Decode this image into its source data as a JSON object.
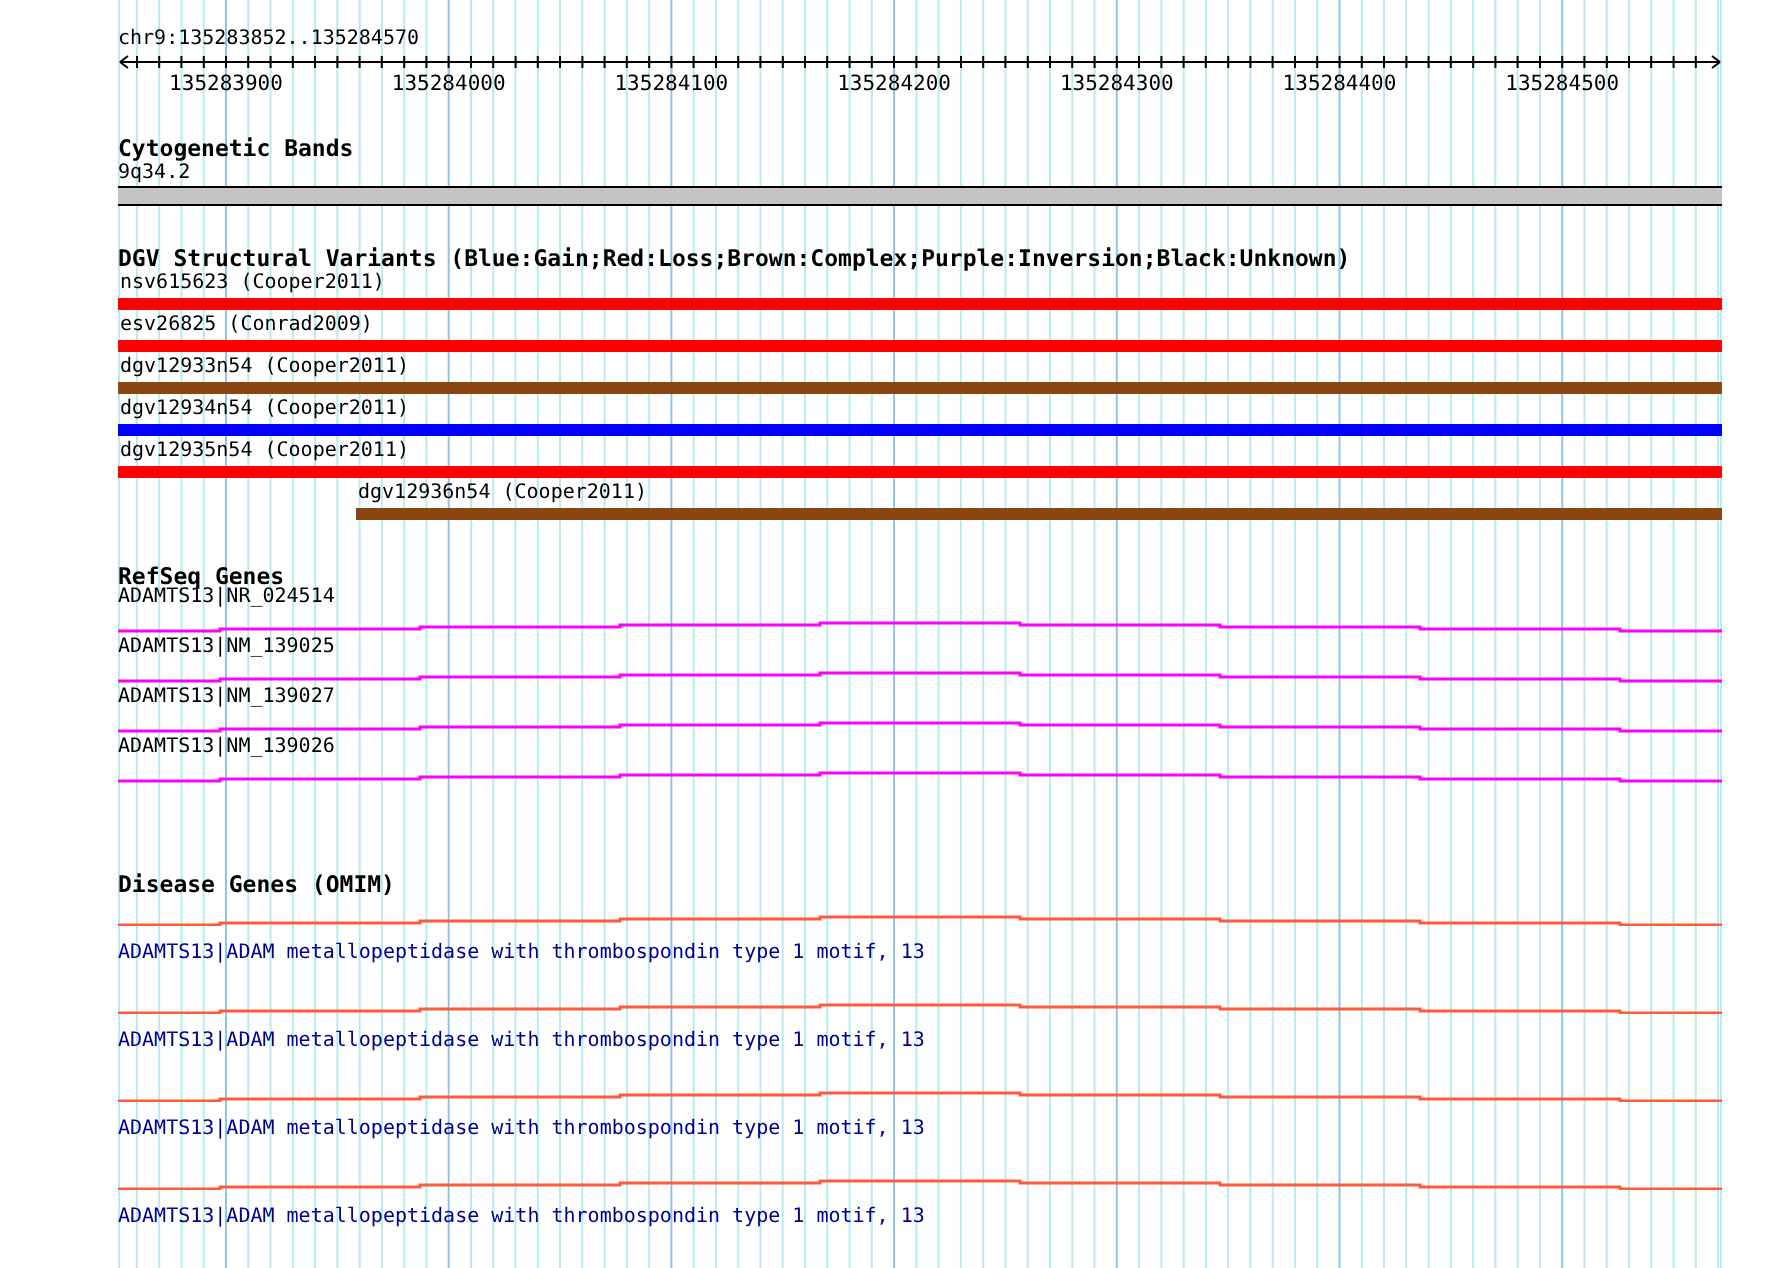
{
  "locus": "chr9:135283852..135284570",
  "ruler": {
    "tick_labels": [
      "135283900",
      "135284000",
      "135284100",
      "135284200",
      "135284300",
      "135284400",
      "135284500"
    ]
  },
  "cytoband_track": {
    "title": "Cytogenetic Bands",
    "band": "9q34.2"
  },
  "variant_track": {
    "title": "DGV Structural Variants (Blue:Gain;Red:Loss;Brown:Complex;Purple:Inversion;Black:Unknown)",
    "features": [
      {
        "label": "nsv615623 (Cooper2011)",
        "color": "#ff0000",
        "starts_in_view": false
      },
      {
        "label": "esv26825 (Conrad2009)",
        "color": "#ff0000",
        "starts_in_view": false
      },
      {
        "label": "dgv12933n54 (Cooper2011)",
        "color": "#8b4513",
        "starts_in_view": false
      },
      {
        "label": "dgv12934n54 (Cooper2011)",
        "color": "#0000ff",
        "starts_in_view": false
      },
      {
        "label": "dgv12935n54 (Cooper2011)",
        "color": "#ff0000",
        "starts_in_view": false
      },
      {
        "label": "dgv12936n54 (Cooper2011)",
        "color": "#8b4513",
        "starts_in_view": true
      }
    ]
  },
  "refseq_track": {
    "title": "RefSeq Genes",
    "genes": [
      {
        "label": "ADAMTS13|NR_024514"
      },
      {
        "label": "ADAMTS13|NM_139025"
      },
      {
        "label": "ADAMTS13|NM_139027"
      },
      {
        "label": "ADAMTS13|NM_139026"
      }
    ]
  },
  "disease_track": {
    "title": "Disease Genes (OMIM)",
    "genes": [
      {
        "label": "ADAMTS13|ADAM metallopeptidase with thrombospondin type 1 motif, 13"
      },
      {
        "label": "ADAMTS13|ADAM metallopeptidase with thrombospondin type 1 motif, 13"
      },
      {
        "label": "ADAMTS13|ADAM metallopeptidase with thrombospondin type 1 motif, 13"
      },
      {
        "label": "ADAMTS13|ADAM metallopeptidase with thrombospondin type 1 motif, 13"
      }
    ]
  }
}
